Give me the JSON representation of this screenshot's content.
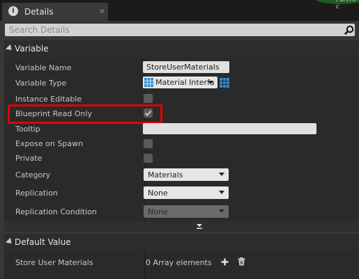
{
  "tab": {
    "title": "Details",
    "close": "✕",
    "icon": "info-details-icon",
    "corner_text": "Parent c"
  },
  "search": {
    "placeholder": "Search Details"
  },
  "sections": {
    "variable": {
      "title": "Variable",
      "rows": {
        "variable_name": {
          "label": "Variable Name",
          "value": "StoreUserMaterials"
        },
        "variable_type": {
          "label": "Variable Type",
          "value": "Material Interfa"
        },
        "instance_editable": {
          "label": "Instance Editable",
          "checked": false
        },
        "blueprint_read_only": {
          "label": "Blueprint Read Only",
          "checked": true
        },
        "tooltip": {
          "label": "Tooltip",
          "value": ""
        },
        "expose_on_spawn": {
          "label": "Expose on Spawn",
          "checked": false
        },
        "private": {
          "label": "Private",
          "checked": false
        },
        "category": {
          "label": "Category",
          "value": "Materials"
        },
        "replication": {
          "label": "Replication",
          "value": "None"
        },
        "replication_condition": {
          "label": "Replication Condition",
          "value": "None"
        }
      }
    },
    "default_value": {
      "title": "Default Value",
      "rows": {
        "store_user_materials": {
          "label": "Store User Materials",
          "value": "0 Array elements"
        }
      }
    }
  },
  "colors": {
    "highlight": "#e50000",
    "type_grid": "#2a8fd8",
    "panel": "#373737",
    "row_bg": "#2a2a2a"
  }
}
